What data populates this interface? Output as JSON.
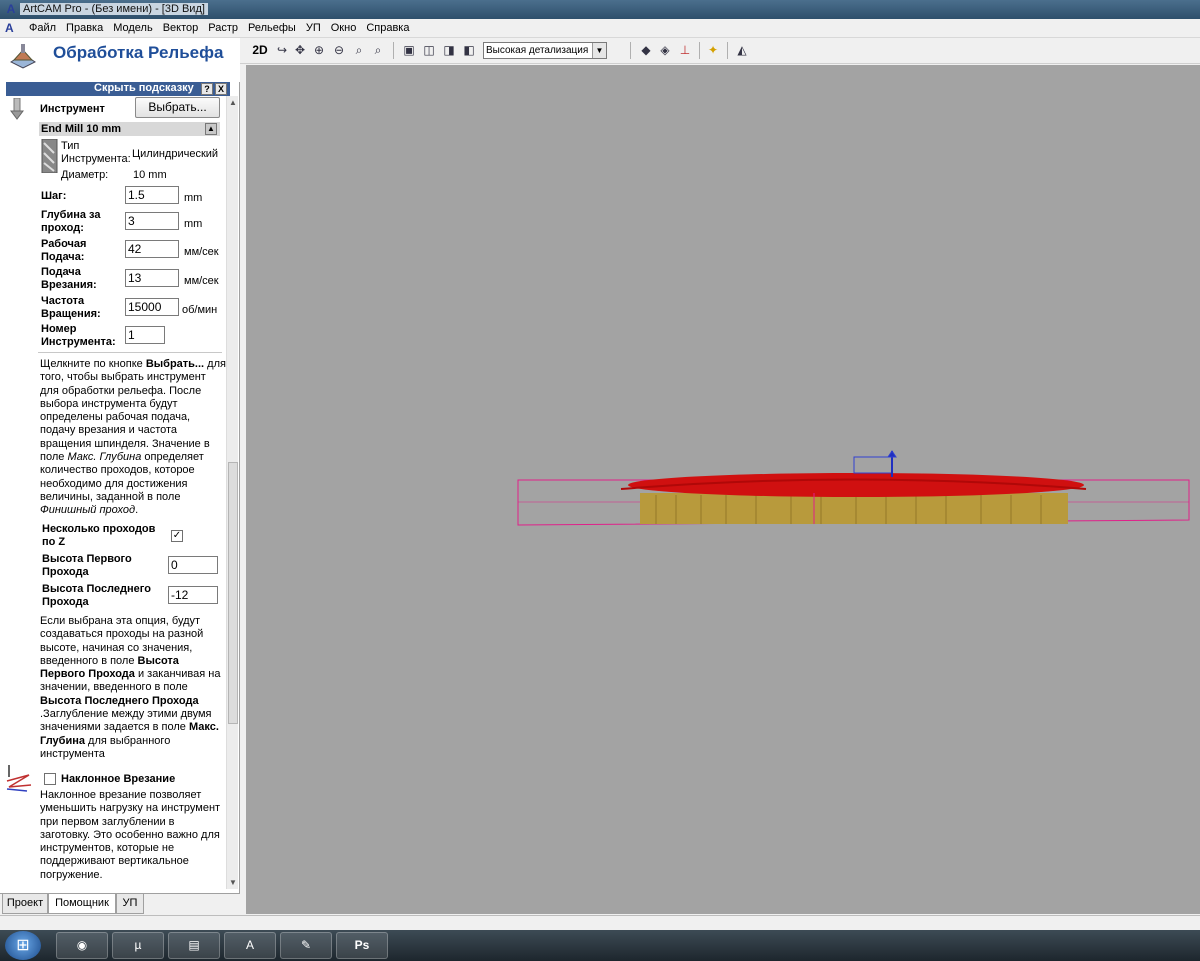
{
  "window": {
    "title": "ArtCAM Pro - (Без имени) - [3D Вид]",
    "app_icon": "artcam-logo-icon"
  },
  "menu": [
    "Файл",
    "Правка",
    "Модель",
    "Вектор",
    "Растр",
    "Рельефы",
    "УП",
    "Окно",
    "Справка"
  ],
  "panel": {
    "title": "Обработка Рельефа",
    "hint_label": "Скрыть подсказку",
    "hint_help": "?",
    "hint_close": "X",
    "tool_label": "Инструмент",
    "select_button": "Выбрать...",
    "tool_name": "End Mill 10 mm",
    "tool_type_label": "Тип Инструмента:",
    "tool_type_value": "Цилиндрический",
    "diameter_label": "Диаметр:",
    "diameter_value": "10 mm",
    "step_label": "Шаг:",
    "step_value": "1.5",
    "step_unit": "mm",
    "depth_label": "Глубина за проход:",
    "depth_value": "3",
    "depth_unit": "mm",
    "feed_label": "Рабочая Подача:",
    "feed_value": "42",
    "feed_unit": "мм/сек",
    "plunge_label": "Подача Врезания:",
    "plunge_value": "13",
    "plunge_unit": "мм/сек",
    "spindle_label": "Частота Вращения:",
    "spindle_value": "15000",
    "spindle_unit": "об/мин",
    "toolnum_label": "Номер Инструмента:",
    "toolnum_value": "1",
    "help1_a": "Щелкните по кнопке ",
    "help1_b": "Выбрать...",
    "help1_c": " для того, чтобы выбрать инструмент для обработки рельефа. После выбора инструмента будут определены рабочая подача, подачу врезания и частота вращения шпинделя. Значение в поле ",
    "help1_d": "Макс. Глубина",
    "help1_e": " определяет количество проходов, которое необходимо для достижения величины, заданной в поле ",
    "help1_f": "Финишный проход",
    "help1_g": ".",
    "multipass_label": "Несколько проходов по Z",
    "multipass_checked": "✓",
    "first_pass_label": "Высота Первого Прохода",
    "first_pass_value": "0",
    "last_pass_label": "Высота Последнего Прохода",
    "last_pass_value": "-12",
    "help2_a": "Если выбрана эта опция, будут создаваться проходы на разной высоте, начиная со значения, введенного в поле ",
    "help2_b": "Высота Первого Прохода",
    "help2_c": " и заканчивая на значении, введенного в поле ",
    "help2_d": "Высота Последнего Прохода",
    "help2_e": " .Заглубление между этими двумя значениями задается в поле ",
    "help2_f": "Макс. Глубина",
    "help2_g": " для выбранного инструмента",
    "ramp_label": "Наклонное Врезание",
    "help3": "Наклонное врезание позволяет уменьшить нагрузку на инструмент при первом заглублении в заготовку. Это особенно важно для инструментов, которые не поддерживают вертикальное погружение.",
    "tabs": [
      "Проект",
      "Помощник",
      "УП"
    ]
  },
  "toolbar": {
    "mode_2d": "2D",
    "detail_value": "Высокая детализация"
  },
  "colors": {
    "title_blue": "#1f4e99",
    "relief_red": "#d01010",
    "relief_gold": "#b89a3c",
    "bbox_magenta": "#e0208a",
    "viewport_gray": "#a3a3a3"
  },
  "taskbar": {
    "apps": [
      "firefox-icon",
      "utorrent-icon",
      "explorer-icon",
      "artcam-icon",
      "notepad-icon",
      "photoshop-icon"
    ],
    "ps_label": "Ps"
  }
}
